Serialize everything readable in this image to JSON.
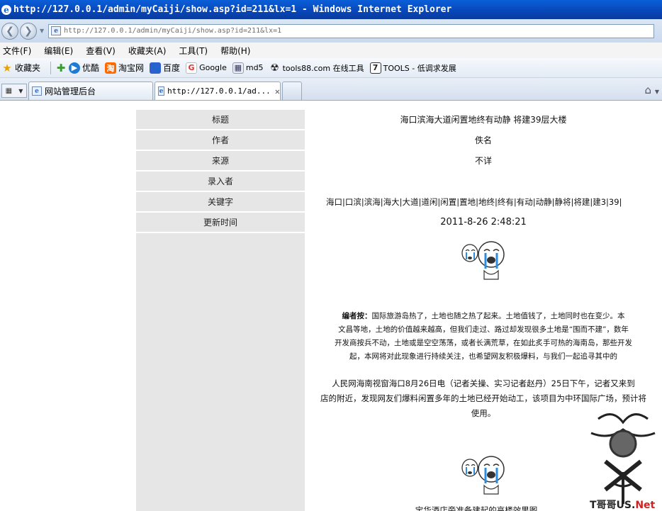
{
  "window": {
    "title": "http://127.0.0.1/admin/myCaiji/show.asp?id=211&lx=1 - Windows Internet Explorer"
  },
  "address": {
    "url": "http://127.0.0.1/admin/myCaiji/show.asp?id=211&lx=1"
  },
  "menu": [
    "文件(F)",
    "编辑(E)",
    "查看(V)",
    "收藏夹(A)",
    "工具(T)",
    "帮助(H)"
  ],
  "favorites": {
    "label": "收藏夹",
    "items": [
      {
        "label": "优酷",
        "icon": "youku-icon"
      },
      {
        "label": "淘宝网",
        "icon": "taobao-icon"
      },
      {
        "label": "百度",
        "icon": "baidu-icon"
      },
      {
        "label": "Google",
        "icon": "google-icon"
      },
      {
        "label": "md5",
        "icon": "md5-icon"
      },
      {
        "label": "tools88.com 在线工具",
        "icon": "radiation-icon"
      },
      {
        "label": "TOOLS - 低调求发展",
        "icon": "tools-icon"
      }
    ]
  },
  "tabs": [
    {
      "label": "网站管理后台",
      "active": false
    },
    {
      "label": "http://127.0.0.1/ad...",
      "active": true
    }
  ],
  "detail": {
    "rows": [
      {
        "label": "标题",
        "value": "海口滨海大道闲置地终有动静 将建39层大楼"
      },
      {
        "label": "作者",
        "value": "佚名"
      },
      {
        "label": "来源",
        "value": "不详"
      },
      {
        "label": "录入者",
        "value": ""
      },
      {
        "label": "关键字",
        "value": "海口|口滨|滨海|海大|大道|道闲|闲置|置地|地终|终有|有动|动静|静将|将建|建3|39|"
      },
      {
        "label": "更新时间",
        "value": "2011-8-26 2:48:21"
      }
    ],
    "body": {
      "note_lines": [
        "编者按：国际旅游岛热了，土地也随之热了起来。土地值钱了，土地同时也在变少。本",
        "文昌等地，土地的价值越来越高，但我们走过、路过却发现很多土地是“围而不建”，数年",
        "开发商按兵不动，土地或是空空荡荡，或者长满荒草，在如此炙手可热的海南岛，那些开发",
        "起，本网将对此现象进行持续关注，也希望网友积极爆料，与我们一起追寻其中的"
      ],
      "para_lines": [
        "人民网海南视窗海口8月26日电（记者关操、实习记者赵丹）25日下午，记者又来到",
        "店的附近，发现网友们爆料闲置多年的土地已经开始动工，该项目为中环国际广场，预计将",
        "使用。"
      ],
      "caption": "宝华酒店旁准备建起的高楼效果图",
      "watermark": "T哥哥US.Net"
    }
  }
}
